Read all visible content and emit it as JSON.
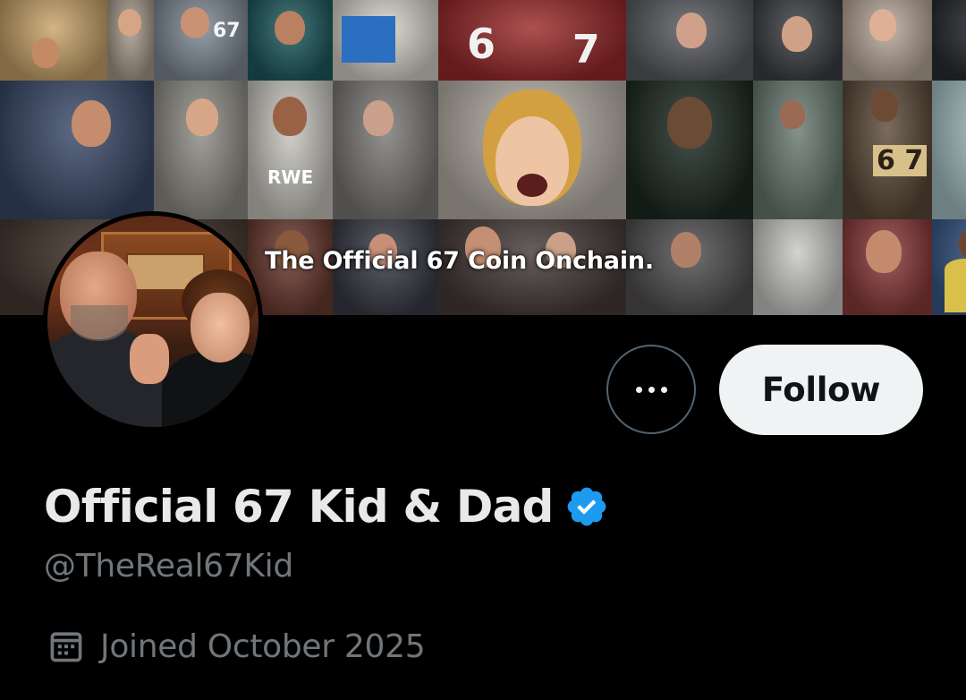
{
  "banner": {
    "overlay_text": "The Official 67 Coin Onchain.",
    "jersey_numbers": [
      "6",
      "7"
    ],
    "shirt_text": "RWE",
    "sign_text": "6 7",
    "top_sign_text": "67"
  },
  "profile": {
    "display_name": "Official 67 Kid & Dad",
    "handle": "@TheReal67Kid",
    "verified": true,
    "joined": "Joined October 2025"
  },
  "actions": {
    "follow_label": "Follow",
    "more_icon": "more-horizontal-icon"
  },
  "icons": {
    "verified": "verified-badge-icon",
    "calendar": "calendar-icon"
  },
  "colors": {
    "background": "#000000",
    "primary_text": "#e7e9ea",
    "secondary_text": "#71767b",
    "verified_blue": "#1d9bf0",
    "follow_bg": "#eff3f4",
    "follow_text": "#0f1419",
    "button_border": "#536471"
  }
}
